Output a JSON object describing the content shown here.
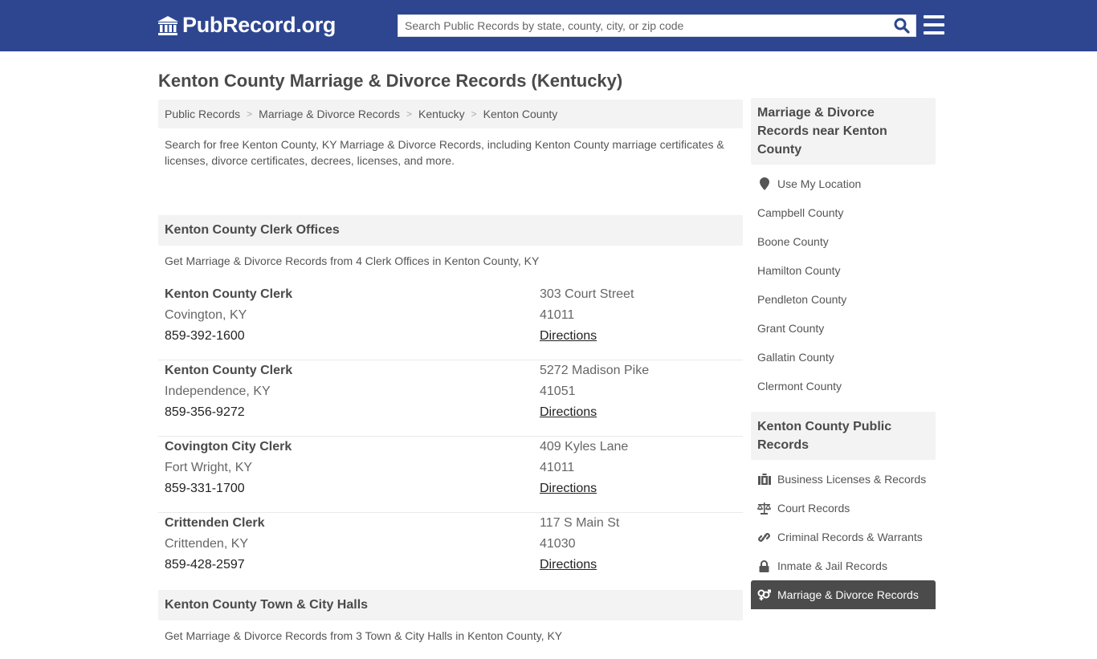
{
  "header": {
    "logo_text": "PubRecord.org",
    "search_placeholder": "Search Public Records by state, county, city, or zip code",
    "search_value": ""
  },
  "page": {
    "title": "Kenton County Marriage & Divorce Records (Kentucky)",
    "breadcrumb": [
      "Public Records",
      "Marriage & Divorce Records",
      "Kentucky",
      "Kenton County"
    ],
    "intro": "Search for free Kenton County, KY Marriage & Divorce Records, including Kenton County marriage certificates & licenses, divorce certificates, decrees, licenses, and more."
  },
  "clerk_section": {
    "title": "Kenton County Clerk Offices",
    "subtitle": "Get Marriage & Divorce Records from 4 Clerk Offices in Kenton County, KY",
    "offices": [
      {
        "name": "Kenton County Clerk",
        "city": "Covington, KY",
        "phone": "859-392-1600",
        "address": "303 Court Street",
        "zip": "41011",
        "directions": "Directions"
      },
      {
        "name": "Kenton County Clerk",
        "city": "Independence, KY",
        "phone": "859-356-9272",
        "address": "5272 Madison Pike",
        "zip": "41051",
        "directions": "Directions"
      },
      {
        "name": "Covington City Clerk",
        "city": "Fort Wright, KY",
        "phone": "859-331-1700",
        "address": "409 Kyles Lane",
        "zip": "41011",
        "directions": "Directions"
      },
      {
        "name": "Crittenden Clerk",
        "city": "Crittenden, KY",
        "phone": "859-428-2597",
        "address": "117 S Main St",
        "zip": "41030",
        "directions": "Directions"
      }
    ]
  },
  "halls_section": {
    "title": "Kenton County Town & City Halls",
    "subtitle": "Get Marriage & Divorce Records from 3 Town & City Halls in Kenton County, KY"
  },
  "sidebar": {
    "nearby_title": "Marriage & Divorce Records near Kenton County",
    "use_location": "Use My Location",
    "nearby": [
      "Campbell County",
      "Boone County",
      "Hamilton County",
      "Pendleton County",
      "Grant County",
      "Gallatin County",
      "Clermont County"
    ],
    "public_title": "Kenton County Public Records",
    "public_items": [
      {
        "label": "Business Licenses & Records",
        "icon": "briefcase-icon"
      },
      {
        "label": "Court Records",
        "icon": "scales-icon"
      },
      {
        "label": "Criminal Records & Warrants",
        "icon": "link-icon"
      },
      {
        "label": "Inmate & Jail Records",
        "icon": "lock-icon"
      },
      {
        "label": "Marriage & Divorce Records",
        "icon": "gender-icon",
        "active": true
      }
    ]
  },
  "colors": {
    "header_bg": "#2e4690",
    "search_icon": "#2e4690",
    "active_bg": "#4b4b4b"
  }
}
